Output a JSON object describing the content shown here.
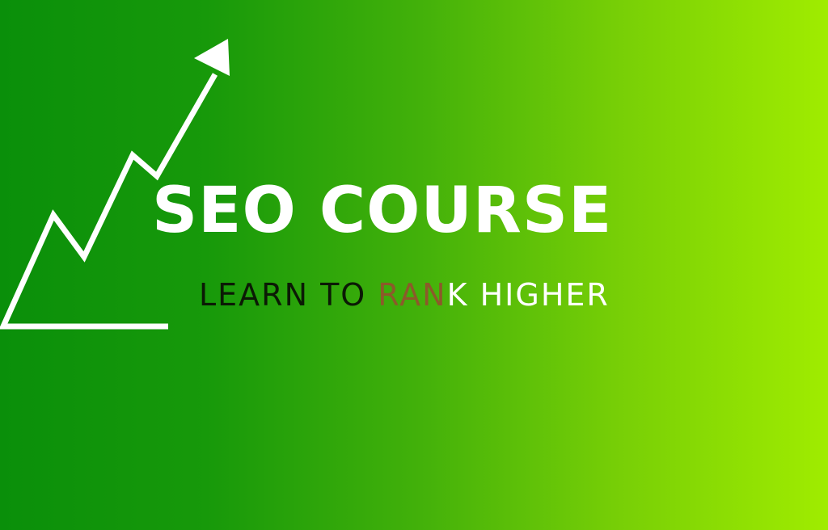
{
  "banner": {
    "title": "SEO COURSE",
    "subtitle_segments": [
      {
        "text": "LEARN TO ",
        "color": "#0b1a05"
      },
      {
        "text": "RAN",
        "color": "#8c5a2a"
      },
      {
        "text": "K HIGHER",
        "color": "#ffffff"
      }
    ],
    "graphic": "trending-up-arrow-icon",
    "colors": {
      "gradient_start": "#0a8f0a",
      "gradient_end": "#a0ec00",
      "title": "#ffffff"
    }
  }
}
